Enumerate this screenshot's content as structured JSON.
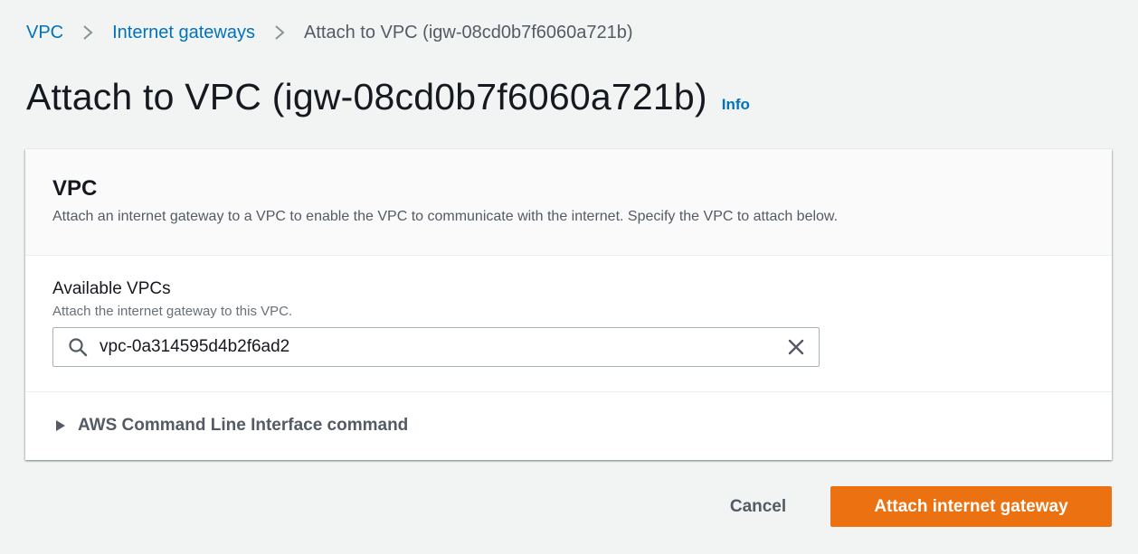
{
  "breadcrumb": {
    "items": [
      {
        "label": "VPC"
      },
      {
        "label": "Internet gateways"
      },
      {
        "label": "Attach to VPC (igw-08cd0b7f6060a721b)"
      }
    ]
  },
  "page": {
    "title": "Attach to VPC (igw-08cd0b7f6060a721b)",
    "info_link": "Info"
  },
  "card": {
    "title": "VPC",
    "description": "Attach an internet gateway to a VPC to enable the VPC to communicate with the internet. Specify the VPC to attach below.",
    "field": {
      "label": "Available VPCs",
      "description": "Attach the internet gateway to this VPC.",
      "value": "vpc-0a314595d4b2f6ad2"
    },
    "expander": {
      "label": "AWS Command Line Interface command",
      "expanded": false
    }
  },
  "footer": {
    "cancel_label": "Cancel",
    "submit_label": "Attach internet gateway"
  },
  "icons": [
    "chevron-right-icon",
    "search-icon",
    "clear-icon",
    "caret-right-icon"
  ],
  "colors": {
    "link": "#0073bb",
    "primary": "#ec7211",
    "background": "#f2f3f3",
    "text": "#16191f",
    "secondary_text": "#545b64"
  }
}
